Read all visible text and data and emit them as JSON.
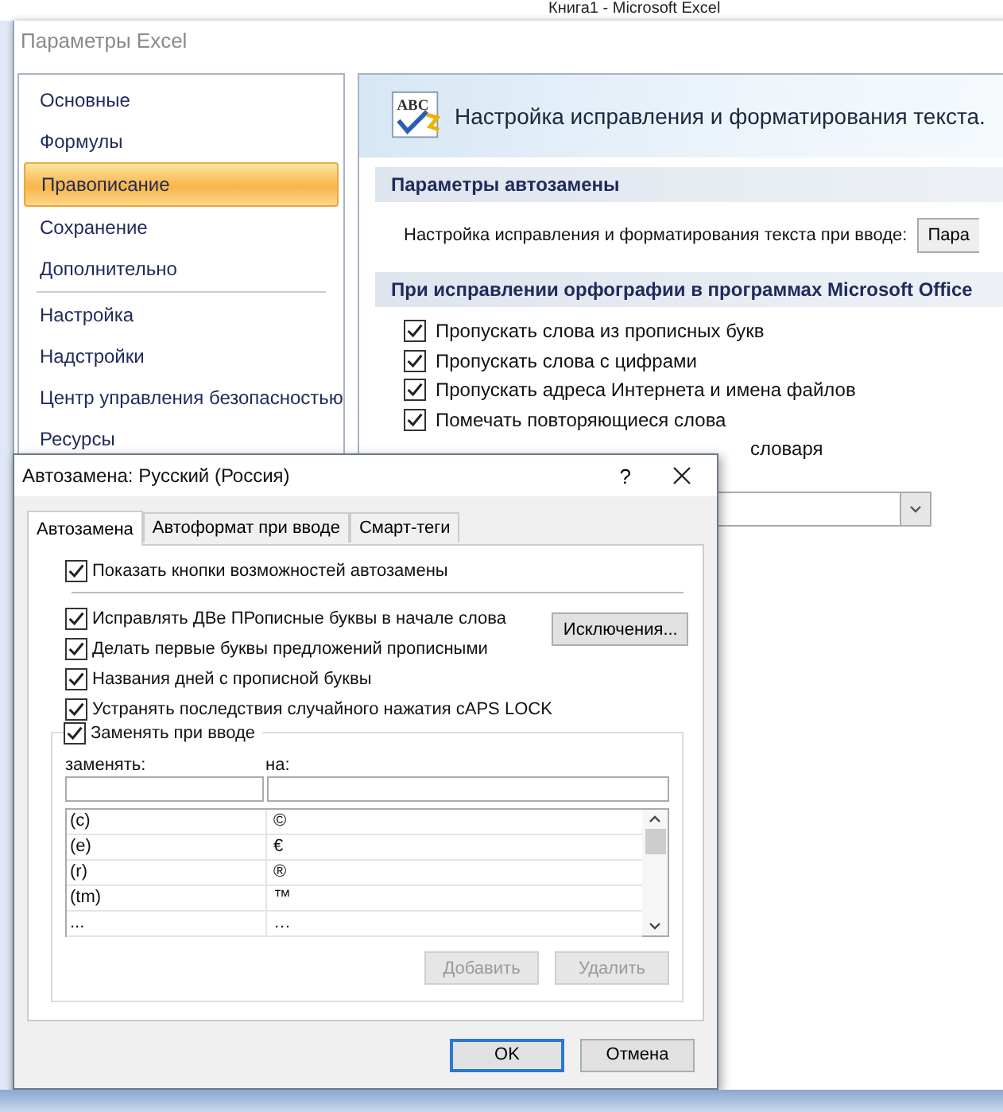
{
  "background_window": {
    "title": "Книга1 - Microsoft Excel"
  },
  "options_dialog": {
    "title": "Параметры Excel",
    "sidebar": {
      "groups": [
        [
          {
            "label": "Основные",
            "selected": false
          },
          {
            "label": "Формулы",
            "selected": false
          },
          {
            "label": "Правописание",
            "selected": true
          },
          {
            "label": "Сохранение",
            "selected": false
          },
          {
            "label": "Дополнительно",
            "selected": false
          }
        ],
        [
          {
            "label": "Настройка",
            "selected": false
          },
          {
            "label": "Надстройки",
            "selected": false
          },
          {
            "label": "Центр управления безопасностью",
            "selected": false
          },
          {
            "label": "Ресурсы",
            "selected": false
          }
        ]
      ]
    },
    "header_icon_text": "ABC",
    "header": "Настройка исправления и форматирования текста.",
    "sections": [
      {
        "title": "Параметры автозамены",
        "rows": [
          {
            "kind": "button-row",
            "label": "Настройка исправления и форматирования текста при вводе:",
            "button": "Пара"
          }
        ]
      },
      {
        "title": "При исправлении орфографии в программах Microsoft Office",
        "rows": [
          {
            "kind": "checkbox",
            "label": "Пропускать слова из прописных букв",
            "checked": true
          },
          {
            "kind": "checkbox",
            "label": "Пропускать слова с цифрами",
            "checked": true
          },
          {
            "kind": "checkbox",
            "label": "Пропускать адреса Интернета и имена файлов",
            "checked": true
          },
          {
            "kind": "checkbox",
            "label": "Помечать повторяющиеся слова",
            "checked": true
          },
          {
            "kind": "fragment",
            "label": "словаря"
          },
          {
            "kind": "dropdown"
          }
        ]
      }
    ]
  },
  "autocorrect_dialog": {
    "title": "Автозамена: Русский (Россия)",
    "help": "?",
    "tabs": [
      {
        "label": "Автозамена",
        "selected": true
      },
      {
        "label": "Автоформат при вводе",
        "selected": false
      },
      {
        "label": "Смарт-теги",
        "selected": false
      }
    ],
    "show_buttons": {
      "label": "Показать кнопки возможностей автозамены",
      "checked": true
    },
    "options": [
      {
        "label": "Исправлять ДВе ПРописные буквы в начале слова",
        "checked": true
      },
      {
        "label": "Делать первые буквы предложений прописными",
        "checked": true
      },
      {
        "label": "Названия дней с прописной буквы",
        "checked": true
      },
      {
        "label": "Устранять последствия случайного нажатия cAPS LOCK",
        "checked": true
      }
    ],
    "exceptions_button": "Исключения...",
    "replace_group": {
      "label": "Заменять при вводе",
      "checked": true,
      "replace_label": "заменять:",
      "with_label": "на:",
      "rows": [
        {
          "from": "(c)",
          "to": "©"
        },
        {
          "from": "(e)",
          "to": "€"
        },
        {
          "from": "(r)",
          "to": "®"
        },
        {
          "from": "(tm)",
          "to": "™"
        },
        {
          "from": "...",
          "to": "…"
        }
      ],
      "buttons": [
        {
          "label": "Добавить",
          "disabled": true
        },
        {
          "label": "Удалить",
          "disabled": true
        }
      ]
    },
    "footer_buttons": [
      {
        "label": "OK",
        "default": true
      },
      {
        "label": "Отмена",
        "default": false
      }
    ]
  }
}
